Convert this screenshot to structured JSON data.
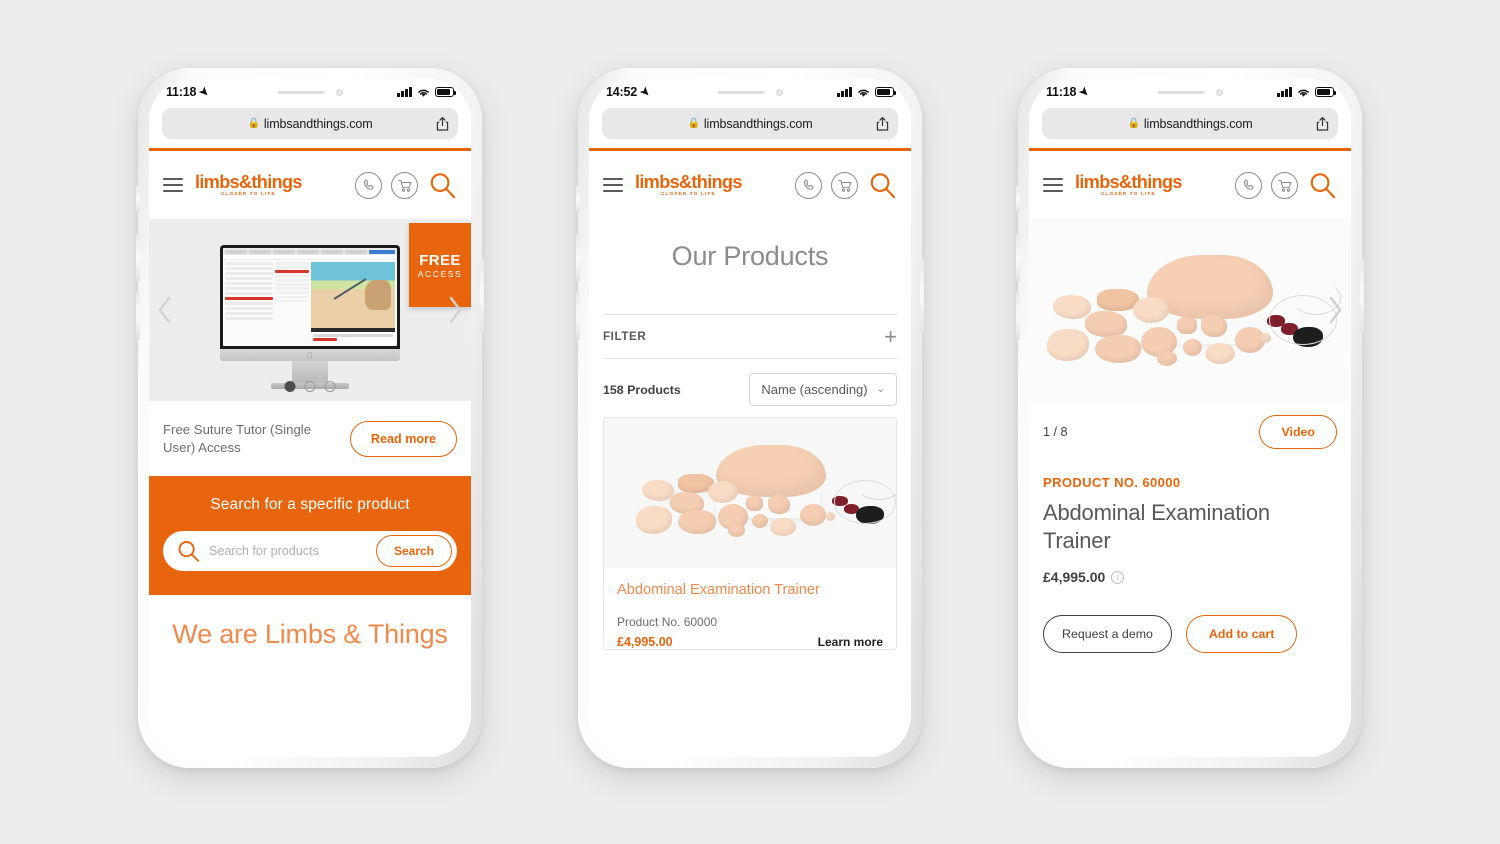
{
  "brand": {
    "name": "limbs&things",
    "tagline": "CLOSER TO LIFE",
    "accent": "#e8650d",
    "accent_light": "#f08a4b",
    "gray_text": "#6d6e71"
  },
  "phones": [
    {
      "id": "phone-home",
      "status": {
        "time": "11:18",
        "location_icon": "location-arrow-icon",
        "signal": "cellular-bars-icon",
        "wifi": "wifi-icon",
        "battery": "battery-icon"
      },
      "browser": {
        "url": "limbsandthings.com",
        "lock_icon": "lock-icon",
        "share_icon": "share-icon"
      },
      "header": {
        "menu_icon": "hamburger-menu-icon",
        "phone_icon": "phone-icon",
        "cart_icon": "cart-icon",
        "search_icon": "search-icon"
      },
      "carousel": {
        "prev_icon": "chevron-left-icon",
        "next_icon": "chevron-right-icon",
        "badge_line1": "FREE",
        "badge_line2": "ACCESS",
        "dots": 3,
        "active_dot": 0
      },
      "promo": {
        "text": "Free Suture Tutor (Single User) Access",
        "button": "Read more"
      },
      "search": {
        "heading": "Search for a specific product",
        "placeholder": "Search for products",
        "button": "Search",
        "icon": "search-icon"
      },
      "headline": "We are Limbs & Things"
    },
    {
      "id": "phone-listing",
      "status": {
        "time": "14:52",
        "location_icon": "location-arrow-icon",
        "signal": "cellular-bars-icon",
        "wifi": "wifi-icon",
        "battery": "battery-icon"
      },
      "browser": {
        "url": "limbsandthings.com",
        "lock_icon": "lock-icon",
        "share_icon": "share-icon"
      },
      "header": {
        "menu_icon": "hamburger-menu-icon",
        "phone_icon": "phone-icon",
        "cart_icon": "cart-icon",
        "search_icon": "search-icon"
      },
      "page_title": "Our Products",
      "filter": {
        "label": "FILTER",
        "expand_icon": "plus-icon"
      },
      "toolbar": {
        "count": "158 Products",
        "sort_value": "Name (ascending)",
        "caret_icon": "chevron-down-icon"
      },
      "product_card": {
        "image_alt": "abdominal-examination-trainer-photo",
        "name": "Abdominal Examination Trainer",
        "product_no": "Product No. 60000",
        "price": "£4,995.00",
        "learn_more": "Learn more"
      }
    },
    {
      "id": "phone-product",
      "status": {
        "time": "11:18",
        "location_icon": "location-arrow-icon",
        "signal": "cellular-bars-icon",
        "wifi": "wifi-icon",
        "battery": "battery-icon"
      },
      "browser": {
        "url": "limbsandthings.com",
        "lock_icon": "lock-icon",
        "share_icon": "share-icon"
      },
      "header": {
        "menu_icon": "hamburger-menu-icon",
        "phone_icon": "phone-icon",
        "cart_icon": "cart-icon",
        "search_icon": "search-icon"
      },
      "gallery": {
        "image_alt": "abdominal-examination-trainer-photo",
        "counter": "1 / 8",
        "next_icon": "chevron-right-icon",
        "video_button": "Video"
      },
      "detail": {
        "sku": "PRODUCT NO. 60000",
        "name": "Abdominal Examination Trainer",
        "price": "£4,995.00",
        "info_icon": "info-icon"
      },
      "actions": {
        "demo": "Request a demo",
        "cart": "Add to cart"
      }
    }
  ]
}
